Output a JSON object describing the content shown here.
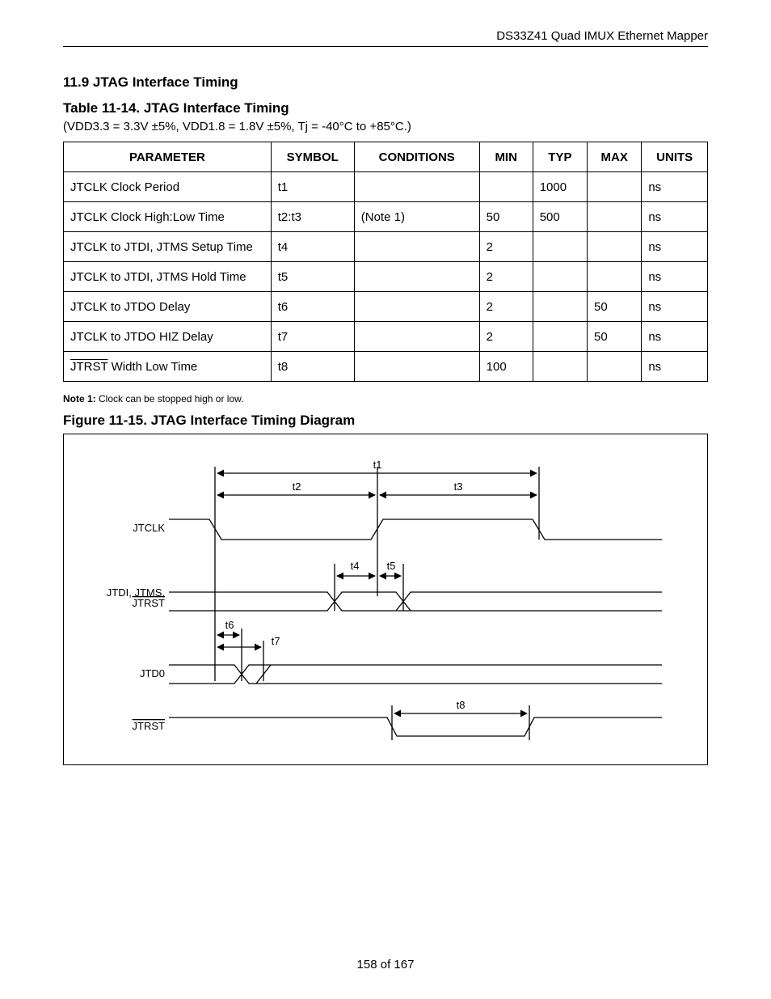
{
  "header": {
    "doc_title": "DS33Z41 Quad IMUX Ethernet Mapper"
  },
  "section": {
    "number": "11.9",
    "title": "JTAG Interface Timing"
  },
  "table": {
    "caption_prefix": "Table 11-14.",
    "caption_title": "JTAG Interface Timing",
    "conditions": "(VDD3.3 = 3.3V ±5%, VDD1.8 = 1.8V ±5%, Tj = -40°C to +85°C.)",
    "cols": {
      "parameter": "PARAMETER",
      "symbol": "SYMBOL",
      "conditions": "CONDITIONS",
      "min": "MIN",
      "typ": "TYP",
      "max": "MAX",
      "units": "UNITS"
    },
    "rows": [
      {
        "parameter": "JTCLK Clock Period",
        "symbol": "t1",
        "conditions": "",
        "min": "",
        "typ": "1000",
        "max": "",
        "units": "ns"
      },
      {
        "parameter": "JTCLK Clock High:Low Time",
        "symbol": "t2:t3",
        "conditions": "(Note 1)",
        "min": "50",
        "typ": "500",
        "max": "",
        "units": "ns"
      },
      {
        "parameter": "JTCLK to JTDI, JTMS Setup Time",
        "symbol": "t4",
        "conditions": "",
        "min": "2",
        "typ": "",
        "max": "",
        "units": "ns"
      },
      {
        "parameter": "JTCLK to JTDI, JTMS Hold Time",
        "symbol": "t5",
        "conditions": "",
        "min": "2",
        "typ": "",
        "max": "",
        "units": "ns"
      },
      {
        "parameter": "JTCLK to JTDO Delay",
        "symbol": "t6",
        "conditions": "",
        "min": "2",
        "typ": "",
        "max": "50",
        "units": "ns"
      },
      {
        "parameter": "JTCLK to JTDO HIZ Delay",
        "symbol": "t7",
        "conditions": "",
        "min": "2",
        "typ": "",
        "max": "50",
        "units": "ns"
      },
      {
        "parameter_prefix": "JTRST",
        "parameter_suffix": "Width Low Time",
        "parameter": "JTRST Width Low Time",
        "symbol": "t8",
        "conditions": "",
        "min": "100",
        "typ": "",
        "max": "",
        "units": "ns"
      }
    ]
  },
  "note1": {
    "label": "Note 1:",
    "text": "Clock can be stopped high or low."
  },
  "figure": {
    "caption_prefix": "Figure 11-15.",
    "caption_title": "JTAG Interface Timing Diagram",
    "labels": {
      "t1": "t1",
      "t2": "t2",
      "t3": "t3",
      "t4": "t4",
      "t5": "t5",
      "t6": "t6",
      "t7": "t7",
      "t8": "t8",
      "jtclk": "JTCLK",
      "jtdi_line1": "JTDI, JTMS,",
      "jtdi_line2": "JTRST",
      "jtdo": "JTD0",
      "jtrst": "JTRST"
    }
  },
  "footer": {
    "page": "158 of 167"
  },
  "chart_data": {
    "type": "table",
    "title": "JTAG Interface Timing",
    "columns": [
      "PARAMETER",
      "SYMBOL",
      "CONDITIONS",
      "MIN",
      "TYP",
      "MAX",
      "UNITS"
    ],
    "rows": [
      [
        "JTCLK Clock Period",
        "t1",
        "",
        "",
        "1000",
        "",
        "ns"
      ],
      [
        "JTCLK Clock High:Low Time",
        "t2:t3",
        "(Note 1)",
        "50",
        "500",
        "",
        "ns"
      ],
      [
        "JTCLK to JTDI, JTMS Setup Time",
        "t4",
        "",
        "2",
        "",
        "",
        "ns"
      ],
      [
        "JTCLK to JTDI, JTMS Hold Time",
        "t5",
        "",
        "2",
        "",
        "",
        "ns"
      ],
      [
        "JTCLK to JTDO Delay",
        "t6",
        "",
        "2",
        "",
        "50",
        "ns"
      ],
      [
        "JTCLK to JTDO HIZ Delay",
        "t7",
        "",
        "2",
        "",
        "50",
        "ns"
      ],
      [
        "JTRST Width Low Time",
        "t8",
        "",
        "100",
        "",
        "",
        "ns"
      ]
    ]
  }
}
